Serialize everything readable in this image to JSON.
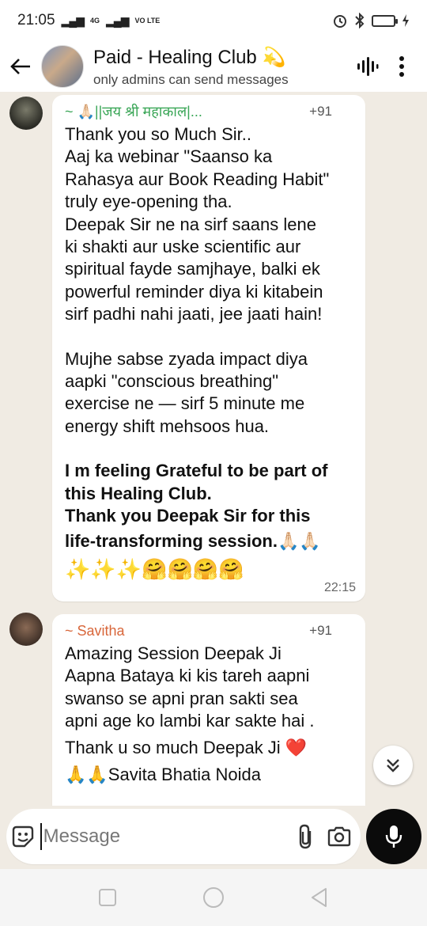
{
  "status_bar": {
    "time": "21:05",
    "signal_1": "▂▄▆",
    "network_small": "4G",
    "signal_2": "▂▄▆",
    "volte": "VO LTE",
    "icons": [
      "alarm-icon",
      "bluetooth-icon",
      "battery-icon",
      "charging-icon"
    ]
  },
  "header": {
    "title": "Paid - Healing Club 💫",
    "subtitle": "only admins can send messages",
    "icons": [
      "back-arrow-icon",
      "voice-chat-icon",
      "more-vert-icon"
    ]
  },
  "messages": [
    {
      "sender": "~ 🙏🏻||जय श्री महाकाल|...",
      "phone": "+91",
      "paragraph_1": "Thank you so Much Sir..\nAaj ka webinar \"Saanso ka\nRahasya aur Book Reading Habit\"\ntruly eye-opening tha.\nDeepak Sir ne na sirf saans lene\nki shakti aur uske scientific aur\nspiritual fayde samjhaye, balki ek\npowerful reminder diya ki kitabein\nsirf padhi nahi jaati, jee jaati hain!",
      "paragraph_2": "Mujhe sabse zyada impact diya\naapki \"conscious breathing\"\nexercise ne — sirf 5 minute me\nenergy shift mehsoos hua.",
      "paragraph_3_bold_1": "I m feeling Grateful to be part of\nthis Healing Club.\nThank you Deepak Sir for this",
      "paragraph_3_bold_2": "life-transforming session.🙏🏻🙏🏻",
      "emoji_line": "✨✨✨🤗🤗🤗🤗",
      "time": "22:15"
    },
    {
      "sender": "~ Savitha",
      "phone": "+91",
      "line_1": "Amazing Session Deepak Ji\nAapna Bataya ki kis tareh aapni\nswanso se apni pran sakti sea\napni age ko lambi  kar sakte hai .",
      "line_2": "Thank u so much Deepak Ji ❤️",
      "line_3": "🙏🙏Savita Bhatia Noida"
    }
  ],
  "input": {
    "placeholder": "Message",
    "icons": [
      "sticker-icon",
      "attach-icon",
      "camera-icon",
      "mic-icon"
    ]
  },
  "nav": {
    "icons": [
      "recents-square-icon",
      "home-circle-icon",
      "back-triangle-icon"
    ]
  },
  "colors": {
    "chat_bg": "#f0ebe3",
    "sender_green": "#3aa657",
    "sender_orange": "#d8663a",
    "mic_bg": "#0b0b0b"
  }
}
